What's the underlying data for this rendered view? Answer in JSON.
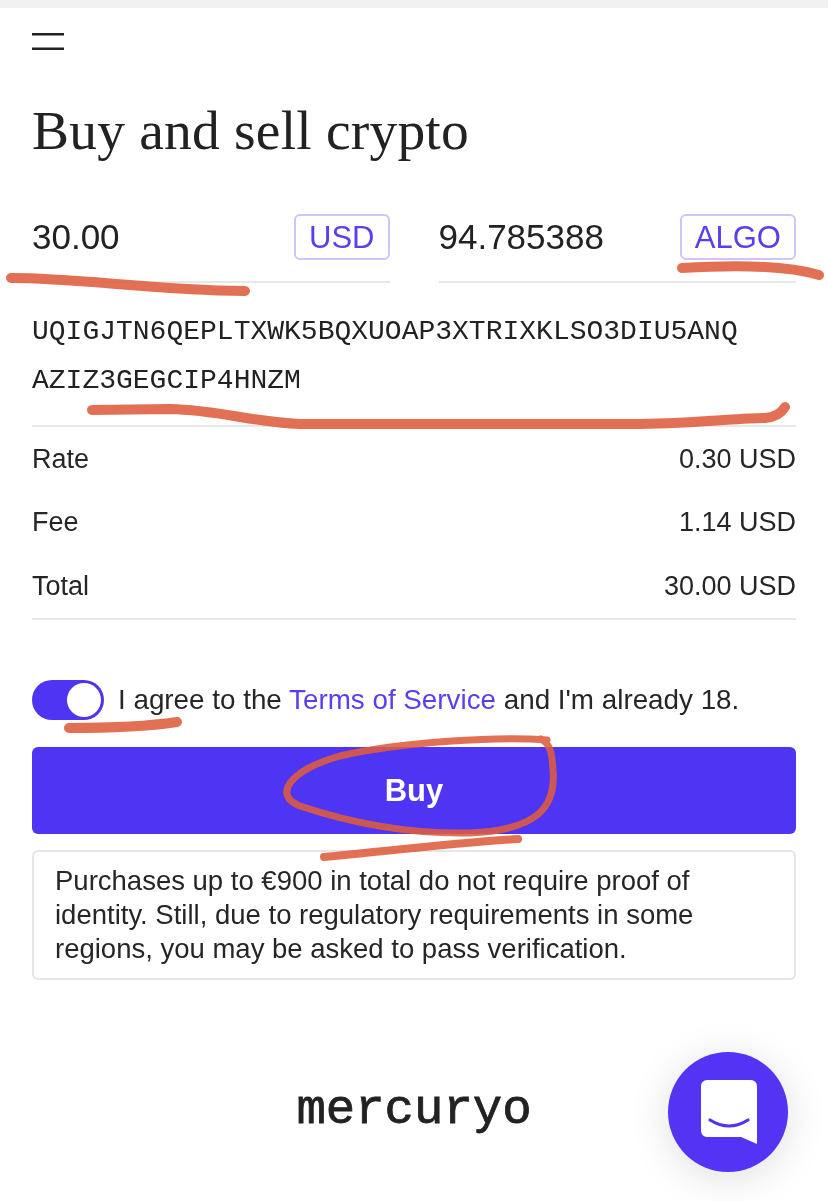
{
  "header": {
    "title": "Buy and sell crypto"
  },
  "amounts": [
    {
      "value": "30.00",
      "currency": "USD"
    },
    {
      "value": "94.785388",
      "currency": "ALGO"
    }
  ],
  "wallet_address": "UQIGJTN6QEPLTXWK5BQXUOAP3XTRIXKLSO3DIU5ANQAZIZ3GEGCIP4HNZM",
  "summary": [
    {
      "label": "Rate",
      "value": "0.30 USD"
    },
    {
      "label": "Fee",
      "value": "1.14 USD"
    },
    {
      "label": "Total",
      "value": "30.00 USD"
    }
  ],
  "agreement": {
    "checked": true,
    "text_before": "I agree to the ",
    "link": "Terms of Service",
    "text_after": " and I'm already 18."
  },
  "buy_button": "Buy",
  "notice": "Purchases up to €900 in total do not require proof of identity. Still, due to regulatory requirements in some regions, you may be asked to pass verification.",
  "footer": {
    "logo": "mercuryo"
  }
}
